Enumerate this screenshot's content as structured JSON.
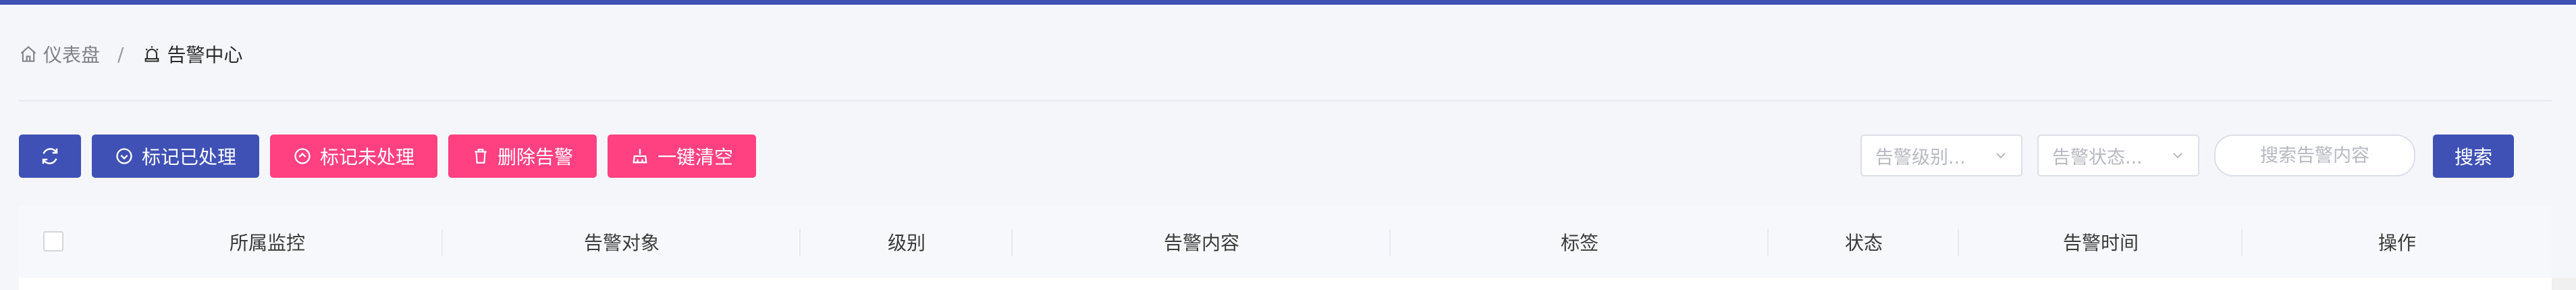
{
  "breadcrumb": {
    "home": "仪表盘",
    "separator": "/",
    "current": "告警中心"
  },
  "toolbar": {
    "refresh_icon": "refresh-icon",
    "mark_handled": "标记已处理",
    "mark_unhandled": "标记未处理",
    "delete_alerts": "删除告警",
    "clear_all": "一键清空"
  },
  "filters": {
    "level_placeholder": "告警级别...",
    "status_placeholder": "告警状态...",
    "search_placeholder": "搜索告警内容",
    "search_button": "搜索"
  },
  "table": {
    "columns": [
      "所属监控",
      "告警对象",
      "级别",
      "告警内容",
      "标签",
      "状态",
      "告警时间",
      "操作"
    ]
  },
  "colors": {
    "primary": "#3f51b5",
    "danger": "#ff4081"
  }
}
